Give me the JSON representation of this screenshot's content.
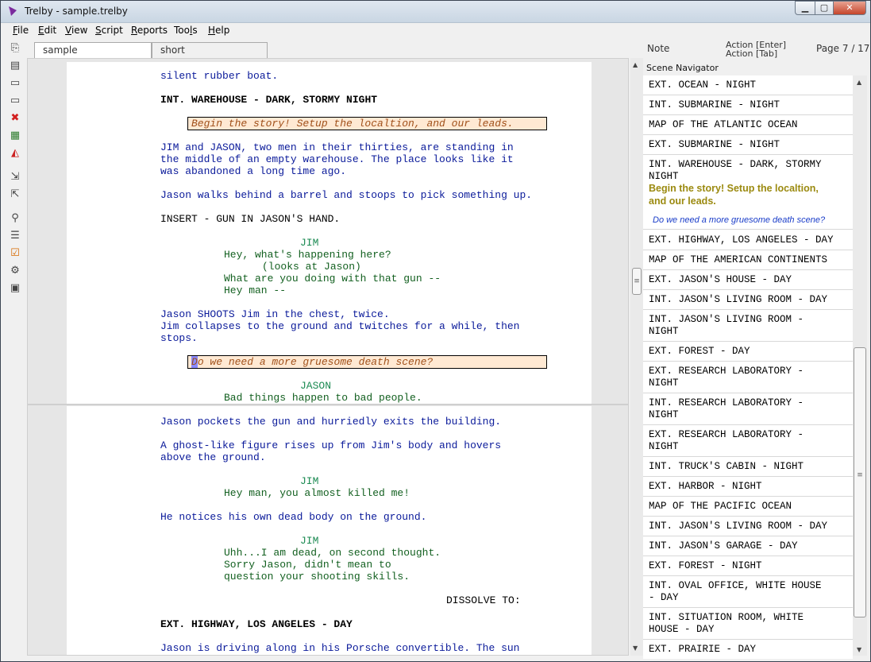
{
  "window": {
    "title": "Trelby - sample.trelby",
    "min": "▁",
    "max": "▢",
    "close": "✕"
  },
  "menu": [
    {
      "u": "F",
      "rest": "ile"
    },
    {
      "u": "E",
      "rest": "dit"
    },
    {
      "u": "V",
      "rest": "iew"
    },
    {
      "u": "S",
      "rest": "cript"
    },
    {
      "u": "R",
      "rest": "eports"
    },
    {
      "u": "T",
      "rest": "ools",
      "pre": "Too",
      "post": "s",
      "mid": "l"
    },
    {
      "u": "H",
      "rest": "elp"
    }
  ],
  "toolbar_icons": [
    "new-script-icon",
    "open-icon",
    "save-icon",
    "save-as-icon",
    "close-script-icon",
    "import-icon",
    "pdf-export-icon",
    "revert-icon",
    "export-icon",
    "find-icon",
    "scene-list-icon",
    "reports-icon",
    "settings-icon",
    "toggle-icon"
  ],
  "tabs": [
    {
      "label": "sample"
    },
    {
      "label": "short"
    }
  ],
  "status": {
    "element": "Note",
    "enter_hint": "Action [Enter]",
    "tab_hint": "Action [Tab]",
    "page": "Page 7 / 17"
  },
  "script": {
    "l01": "silent rubber boat.",
    "l02": "INT. WAREHOUSE - DARK, STORMY NIGHT",
    "note1": "Begin the story! Setup the localtion, and our leads.",
    "l03": "JIM and JASON, two men in their thirties, are standing in",
    "l04": "the middle of an empty warehouse. The place looks like it",
    "l05": "was abandoned a long time ago.",
    "l06": "Jason walks behind a barrel and stoops to pick something up.",
    "l07": "INSERT - GUN IN JASON'S HAND.",
    "c01": "JIM",
    "d01": "Hey, what's happening here?",
    "p01": "(looks at Jason)",
    "d02": "What are you doing with that gun --",
    "d03": "Hey man --",
    "l08": "Jason SHOOTS Jim in the chest, twice.",
    "l09": "Jim collapses to the ground and twitches for a while, then",
    "l10": "stops.",
    "note2_first": "D",
    "note2_rest": "o we need a more gruesome death scene?",
    "c02": "JASON",
    "d04": "Bad things happen to bad people.",
    "l11": "Jason pockets the gun and hurriedly exits the building.",
    "l12": "A ghost-like figure rises up from Jim's body and hovers",
    "l13": "above the ground.",
    "c03": "JIM",
    "d05": "Hey man, you almost killed me!",
    "l14": "He notices his own dead body on the ground.",
    "c04": "JIM",
    "d06": "Uhh...I am dead, on second thought.",
    "d07": "Sorry Jason, didn't mean to",
    "d08": "question your shooting skills.",
    "t01": "DISSOLVE TO:",
    "l15": "EXT. HIGHWAY, LOS ANGELES - DAY",
    "l16": "Jason is driving along in his Porsche convertible. The sun"
  },
  "navigator": {
    "title": "Scene Navigator",
    "items": [
      "EXT. OCEAN - NIGHT",
      "INT. SUBMARINE - NIGHT",
      "MAP OF THE ATLANTIC OCEAN",
      "EXT. SUBMARINE - NIGHT",
      "INT. WAREHOUSE - DARK, STORMY",
      "NIGHT",
      "Begin the story! Setup the localtion,",
      "and our leads.",
      "Do we need a more gruesome death scene?",
      "EXT. HIGHWAY, LOS ANGELES - DAY",
      "MAP OF THE AMERICAN CONTINENTS",
      "EXT. JASON'S HOUSE - DAY",
      "INT. JASON'S LIVING ROOM - DAY",
      "INT. JASON'S LIVING ROOM -",
      "NIGHT",
      "EXT. FOREST - DAY",
      "EXT. RESEARCH LABORATORY -",
      "NIGHT",
      "INT. RESEARCH LABORATORY -",
      "NIGHT",
      "EXT. RESEARCH LABORATORY -",
      "NIGHT",
      "INT. TRUCK'S CABIN - NIGHT",
      "EXT. HARBOR - NIGHT",
      "MAP OF THE PACIFIC OCEAN",
      "INT. JASON'S LIVING ROOM - DAY",
      "INT. JASON'S GARAGE - DAY",
      "EXT. FOREST - NIGHT",
      "INT. OVAL OFFICE, WHITE HOUSE",
      "- DAY",
      "INT. SITUATION ROOM, WHITE",
      "HOUSE - DAY",
      "EXT. PRAIRIE - DAY"
    ]
  }
}
